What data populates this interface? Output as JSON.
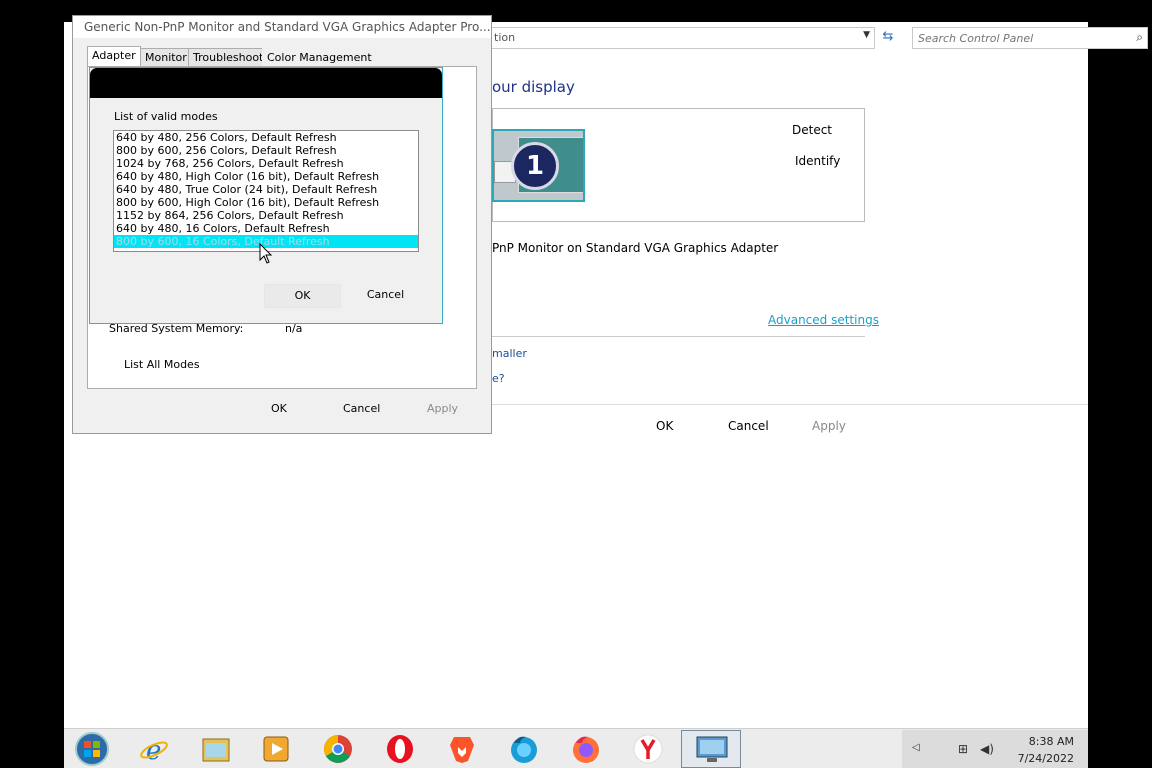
{
  "control_panel": {
    "address_partial": "tion",
    "search_placeholder": "Search Control Panel",
    "heading_partial": "our display",
    "display_number": "1",
    "detect_label": "Detect",
    "identify_label": "Identify",
    "display_desc_partial": "PnP Monitor on Standard VGA Graphics Adapter",
    "advanced_settings": "Advanced settings",
    "smaller_link_partial": "maller",
    "help_link_partial": "e?",
    "ok": "OK",
    "cancel": "Cancel",
    "apply": "Apply"
  },
  "properties": {
    "title": "Generic Non-PnP Monitor and Standard VGA Graphics Adapter Pro...",
    "tabs": [
      "Adapter",
      "Monitor",
      "Troubleshoot",
      "Color Management"
    ],
    "active_tab": "Adapter",
    "shared_memory_label": "Shared System Memory:",
    "shared_memory_value": "n/a",
    "list_all_modes": "List All Modes",
    "ok": "OK",
    "cancel": "Cancel",
    "apply": "Apply"
  },
  "modes_dialog": {
    "label": "List of valid modes",
    "modes": [
      "640 by 480, 256 Colors, Default Refresh",
      "800 by 600, 256 Colors, Default Refresh",
      "1024 by 768, 256 Colors, Default Refresh",
      "640 by 480, High Color (16 bit), Default Refresh",
      "640 by 480, True Color (24 bit), Default Refresh",
      "800 by 600, High Color (16 bit), Default Refresh",
      "1152 by 864, 256 Colors, Default Refresh",
      "640 by 480, 16 Colors, Default Refresh",
      "800 by 600, 16 Colors, Default Refresh"
    ],
    "selected_index": 8,
    "ok": "OK",
    "cancel": "Cancel"
  },
  "taskbar": {
    "pinned": [
      "start-orb-icon",
      "internet-explorer-icon",
      "file-explorer-icon",
      "media-player-icon",
      "chrome-icon",
      "opera-icon",
      "brave-icon",
      "firefox-developer-icon",
      "firefox-icon",
      "yandex-icon",
      "display-settings-icon"
    ],
    "time": "8:38 AM",
    "date": "7/24/2022"
  },
  "colors": {
    "selection": "#00e5f6",
    "link": "#1aa0c8",
    "dialog_border": "#3aaec6"
  }
}
